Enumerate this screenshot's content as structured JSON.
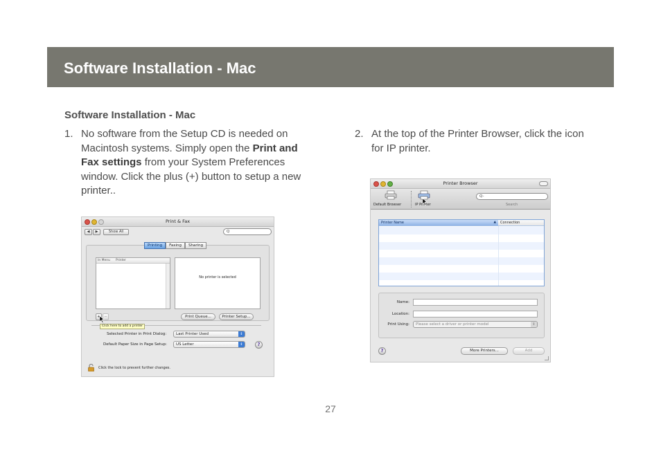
{
  "header": {
    "title": "Software Installation - Mac"
  },
  "section": {
    "heading": "Software Installation - Mac"
  },
  "steps": [
    {
      "number": "1.",
      "text_before": "No software from the Setup CD is needed on Macintosh systems. Simply open the ",
      "bold": "Print and Fax settings",
      "text_after": " from your System Preferences window. Click the plus (+) button to setup a new printer.."
    },
    {
      "number": "2.",
      "text": "At the top of the Printer Browser, click the icon for IP printer."
    }
  ],
  "print_fax_window": {
    "title": "Print & Fax",
    "nav_back": "◀",
    "nav_forward": "▶",
    "show_all": "Show All",
    "search_glyph": "Q",
    "tabs": [
      "Printing",
      "Faxing",
      "Sharing"
    ],
    "active_tab": "Printing",
    "columns": [
      "In Menu",
      "Printer"
    ],
    "empty_detail": "No printer is selected",
    "add_label": "+",
    "remove_label": "−",
    "tooltip": "Click here to add a printer",
    "print_queue": "Print Queue...",
    "printer_setup": "Printer Setup...",
    "selected_printer_label": "Selected Printer in Print Dialog:",
    "selected_printer_value": "Last Printer Used",
    "paper_size_label": "Default Paper Size in Page Setup:",
    "paper_size_value": "US Letter",
    "lock_text": "Click the lock to prevent further changes.",
    "help": "?"
  },
  "printer_browser_window": {
    "title": "Printer Browser",
    "toolbar": [
      {
        "label": "Default Browser",
        "icon": "printer-icon"
      },
      {
        "label": "IP Printer",
        "icon": "ip-printer-icon"
      }
    ],
    "search_glyph": "Q-",
    "search_label": "Search",
    "columns": [
      "Printer Name",
      "Connection"
    ],
    "name_label": "Name:",
    "location_label": "Location:",
    "print_using_label": "Print Using:",
    "print_using_value": "Please select a driver or printer model",
    "more_printers": "More Printers...",
    "add": "Add",
    "help": "?"
  },
  "page": {
    "number": "27"
  },
  "colors": {
    "banner": "#77776f",
    "banner_text": "#ffffff",
    "body_text": "#4a4a4a",
    "selection_blue": "#6aa3e4"
  }
}
